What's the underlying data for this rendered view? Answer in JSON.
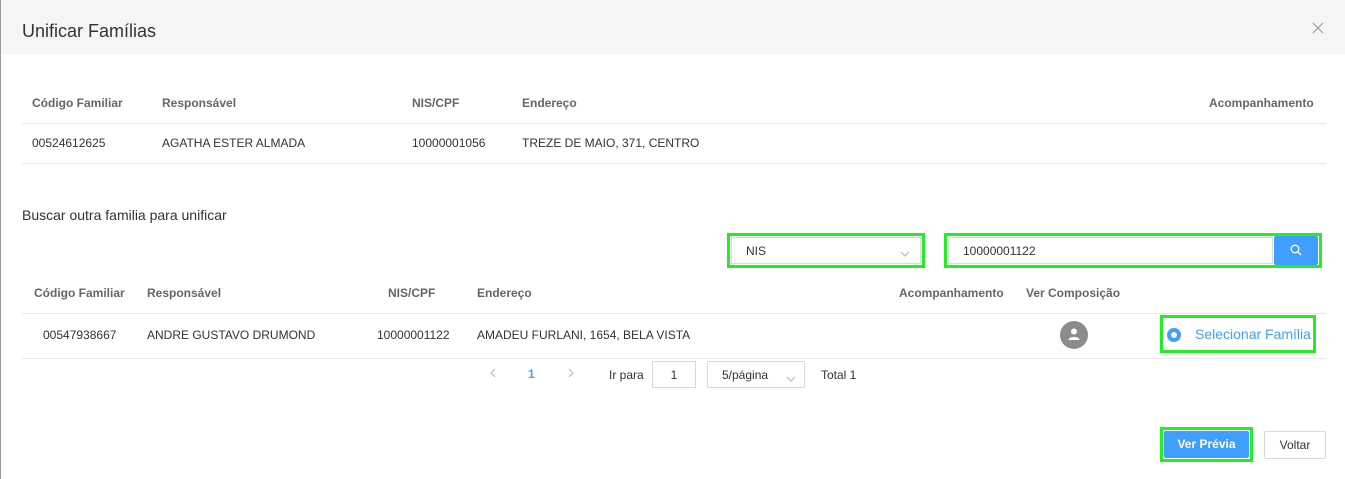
{
  "modal": {
    "title": "Unificar Famílias"
  },
  "current_family_table": {
    "headers": {
      "codigo": "Código Familiar",
      "responsavel": "Responsável",
      "nis_cpf": "NIS/CPF",
      "endereco": "Endereço",
      "acompanhamento": "Acompanhamento"
    },
    "row": {
      "codigo": "00524612625",
      "responsavel": "AGATHA ESTER ALMADA",
      "nis_cpf": "10000001056",
      "endereco": "TREZE DE MAIO, 371, CENTRO",
      "acompanhamento": ""
    }
  },
  "search": {
    "section_label": "Buscar outra familia para unificar",
    "type_selected": "NIS",
    "value": "10000001122"
  },
  "results_table": {
    "headers": {
      "codigo": "Código Familiar",
      "responsavel": "Responsável",
      "nis_cpf": "NIS/CPF",
      "endereco": "Endereço",
      "acompanhamento": "Acompanhamento",
      "ver_composicao": "Ver Composição"
    },
    "row": {
      "codigo": "00547938667",
      "responsavel": "ANDRE GUSTAVO DRUMOND",
      "nis_cpf": "10000001122",
      "endereco": "AMADEU FURLANI, 1654, BELA VISTA",
      "acompanhamento": "",
      "select_label": "Selecionar Família"
    }
  },
  "pagination": {
    "current_page": "1",
    "goto_label": "Ir para",
    "goto_value": "1",
    "page_size": "5/página",
    "total": "Total 1"
  },
  "footer": {
    "preview_label": "Ver Prévia",
    "back_label": "Voltar"
  },
  "colors": {
    "primary": "#409eff",
    "highlight": "#22ee22",
    "header_bg": "#f5f5f5"
  }
}
